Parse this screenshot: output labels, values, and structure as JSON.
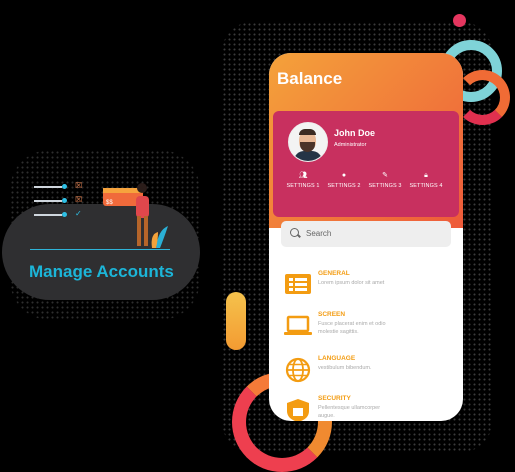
{
  "left_card": {
    "title": "Manage Accounts",
    "colors": {
      "title": "#1cb5d8",
      "card": "#2f2f31"
    }
  },
  "phone": {
    "title": "Balance",
    "profile": {
      "name": "John Doe",
      "role": "Administrator",
      "settings": [
        {
          "label": "SETTINGS 1",
          "icon": "users-icon"
        },
        {
          "label": "SETTINGS 2",
          "icon": "user-circle-icon"
        },
        {
          "label": "SETTINGS 3",
          "icon": "pencil-icon"
        },
        {
          "label": "SETTINGS 4",
          "icon": "lock-icon"
        }
      ]
    },
    "search": {
      "placeholder": "Search"
    },
    "items": [
      {
        "title": "GENERAL",
        "desc": "Lorem ipsum dolor sit amet",
        "icon": "list-icon"
      },
      {
        "title": "SCREEN",
        "desc": "Fusce placerat enim et odio molestie sagittis.",
        "icon": "laptop-icon"
      },
      {
        "title": "LANGUAGE",
        "desc": "vestibulum bibendum.",
        "icon": "globe-icon"
      },
      {
        "title": "SECURITY",
        "desc": "Pellentesque ullamcorper augue.",
        "icon": "shield-icon"
      }
    ],
    "colors": {
      "header_start": "#f4a23a",
      "header_end": "#ee5a3a",
      "profile": "#c8305f",
      "accent": "#f39c12"
    }
  }
}
